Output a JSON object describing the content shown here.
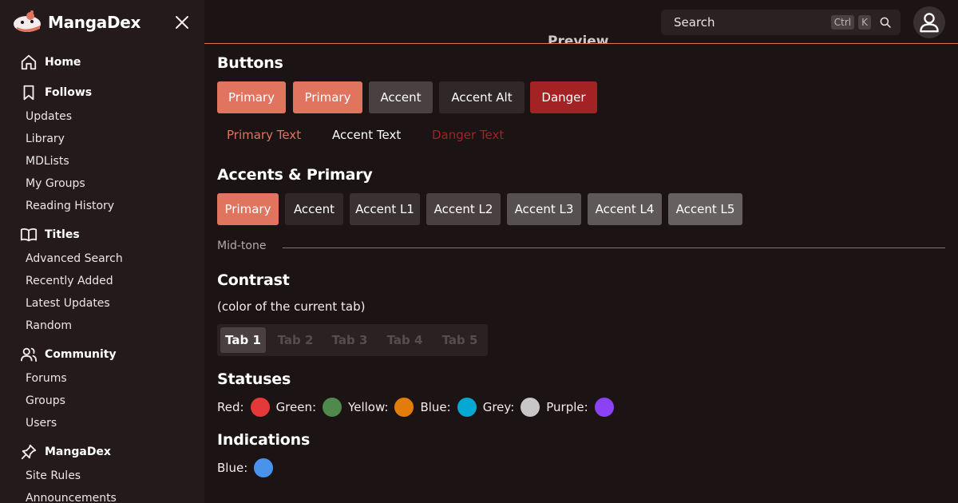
{
  "sidebar": {
    "brand": "MangaDex",
    "sections": [
      {
        "label": "Home",
        "icon": "home-icon",
        "items": []
      },
      {
        "label": "Follows",
        "icon": "bookmark-icon",
        "items": [
          "Updates",
          "Library",
          "MDLists",
          "My Groups",
          "Reading History"
        ]
      },
      {
        "label": "Titles",
        "icon": "book-open-icon",
        "items": [
          "Advanced Search",
          "Recently Added",
          "Latest Updates",
          "Random"
        ]
      },
      {
        "label": "Community",
        "icon": "users-icon",
        "items": [
          "Forums",
          "Groups",
          "Users"
        ]
      },
      {
        "label": "MangaDex",
        "icon": "pin-icon",
        "items": [
          "Site Rules",
          "Announcements"
        ]
      }
    ]
  },
  "topbar": {
    "peek_title": "Preview",
    "search_placeholder": "Search",
    "shortcut_keys": [
      "Ctrl",
      "K"
    ]
  },
  "main": {
    "buttons": {
      "heading": "Buttons",
      "filled": [
        "Primary",
        "Primary",
        "Accent",
        "Accent Alt",
        "Danger"
      ],
      "text": [
        "Primary Text",
        "Accent Text",
        "Danger Text"
      ]
    },
    "accents": {
      "heading": "Accents & Primary",
      "items": [
        "Primary",
        "Accent",
        "Accent L1",
        "Accent L2",
        "Accent L3",
        "Accent L4",
        "Accent L5"
      ],
      "divider_label": "Mid-tone"
    },
    "contrast": {
      "heading": "Contrast",
      "subtitle": "(color of the current tab)",
      "tabs": [
        "Tab 1",
        "Tab 2",
        "Tab 3",
        "Tab 4",
        "Tab 5"
      ],
      "active_tab": 0
    },
    "statuses": {
      "heading": "Statuses",
      "items": [
        {
          "label": "Red:",
          "color": "#e5383b"
        },
        {
          "label": "Green:",
          "color": "#4f8a4c"
        },
        {
          "label": "Yellow:",
          "color": "#e27c0a"
        },
        {
          "label": "Blue:",
          "color": "#05a7d3"
        },
        {
          "label": "Grey:",
          "color": "#c8c6c6"
        },
        {
          "label": "Purple:",
          "color": "#8b42f7"
        }
      ]
    },
    "indications": {
      "heading": "Indications",
      "items": [
        {
          "label": "Blue:",
          "color": "#4a93ec"
        }
      ]
    }
  },
  "colors": {
    "primary": "#e0745f",
    "accent": "#4a4041",
    "accent_alt": "#2f2728",
    "danger": "#a32223",
    "background": "#1c1314",
    "sidebar": "#241a1b"
  }
}
